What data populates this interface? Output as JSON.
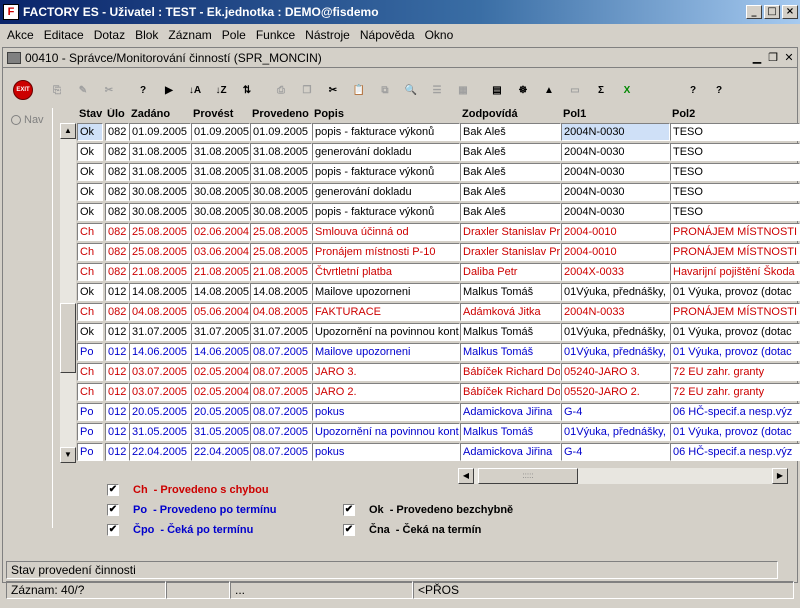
{
  "titlebar": {
    "title": "FACTORY ES - Uživatel : TEST - Ek.jednotka : DEMO@fisdemo",
    "app_icon": "F"
  },
  "menu": [
    "Akce",
    "Editace",
    "Dotaz",
    "Blok",
    "Záznam",
    "Pole",
    "Funkce",
    "Nástroje",
    "Nápověda",
    "Okno"
  ],
  "form": {
    "title": "00410 - Správce/Monitorování činností (SPR_MONCIN)"
  },
  "toolbar": {
    "exit_label": "EXIT"
  },
  "nav": {
    "label": "Nav"
  },
  "columns": [
    "Stav",
    "Úlo",
    "Zadáno",
    "Provést",
    "Provedeno",
    "Popis",
    "Zodpovídá",
    "Pol1",
    "Pol2"
  ],
  "colors": {
    "black": "#000000",
    "red": "#cc0000",
    "blue": "#0000cc"
  },
  "rows": [
    {
      "c": "black",
      "v": [
        "Ok",
        "082",
        "01.09.2005",
        "01.09.2005",
        "01.09.2005",
        "popis - fakturace výkonů",
        "Bak Aleš",
        "2004N-0030",
        "TESO"
      ]
    },
    {
      "c": "black",
      "v": [
        "Ok",
        "082",
        "31.08.2005",
        "31.08.2005",
        "31.08.2005",
        "generování dokladu",
        "Bak Aleš",
        "2004N-0030",
        "TESO"
      ]
    },
    {
      "c": "black",
      "v": [
        "Ok",
        "082",
        "31.08.2005",
        "31.08.2005",
        "31.08.2005",
        "popis - fakturace výkonů",
        "Bak Aleš",
        "2004N-0030",
        "TESO"
      ]
    },
    {
      "c": "black",
      "v": [
        "Ok",
        "082",
        "30.08.2005",
        "30.08.2005",
        "30.08.2005",
        "generování dokladu",
        "Bak Aleš",
        "2004N-0030",
        "TESO"
      ]
    },
    {
      "c": "black",
      "v": [
        "Ok",
        "082",
        "30.08.2005",
        "30.08.2005",
        "30.08.2005",
        "popis - fakturace výkonů",
        "Bak Aleš",
        "2004N-0030",
        "TESO"
      ]
    },
    {
      "c": "red",
      "v": [
        "Ch",
        "082",
        "25.08.2005",
        "02.06.2004",
        "25.08.2005",
        "Smlouva účinná od",
        "Draxler Stanislav Pr",
        "2004-0010",
        "PRONÁJEM MÍSTNOSTI 3"
      ]
    },
    {
      "c": "red",
      "v": [
        "Ch",
        "082",
        "25.08.2005",
        "03.06.2004",
        "25.08.2005",
        "Pronájem místnosti P-10",
        "Draxler Stanislav Pr",
        "2004-0010",
        "PRONÁJEM MÍSTNOSTI 3"
      ]
    },
    {
      "c": "red",
      "v": [
        "Ch",
        "082",
        "21.08.2005",
        "21.08.2005",
        "21.08.2005",
        "Čtvrtletní platba",
        "Daliba Petr",
        "2004X-0033",
        "Havarijní pojištění  Škoda"
      ]
    },
    {
      "c": "black",
      "v": [
        "Ok",
        "012",
        "14.08.2005",
        "14.08.2005",
        "14.08.2005",
        "Mailove upozorneni",
        "Malkus Tomáš",
        "01Výuka, přednášky,",
        "01 Výuka, provoz (dotac"
      ]
    },
    {
      "c": "red",
      "v": [
        "Ch",
        "082",
        "04.08.2005",
        "05.06.2004",
        "04.08.2005",
        "FAKTURACE",
        "Adámková Jitka",
        "2004N-0033",
        "PRONÁJEM MÍSTNOSTI K"
      ]
    },
    {
      "c": "black",
      "v": [
        "Ok",
        "012",
        "31.07.2005",
        "31.07.2005",
        "31.07.2005",
        "Upozornění na povinnou kontro",
        "Malkus Tomáš",
        "01Výuka, přednášky,",
        "01 Výuka, provoz (dotac"
      ]
    },
    {
      "c": "blue",
      "v": [
        "Po",
        "012",
        "14.06.2005",
        "14.06.2005",
        "08.07.2005",
        "Mailove upozorneni",
        "Malkus Tomáš",
        "01Výuka, přednášky,",
        "01 Výuka, provoz (dotac"
      ]
    },
    {
      "c": "red",
      "v": [
        "Ch",
        "012",
        "03.07.2005",
        "02.05.2004",
        "08.07.2005",
        "JARO 3.",
        "Bábíček Richard Dor",
        "05240-JARO 3.",
        "72 EU zahr. granty"
      ]
    },
    {
      "c": "red",
      "v": [
        "Ch",
        "012",
        "03.07.2005",
        "02.05.2004",
        "08.07.2005",
        "JARO 2.",
        "Bábíček Richard Dor",
        "05520-JARO 2.",
        "72 EU zahr. granty"
      ]
    },
    {
      "c": "blue",
      "v": [
        "Po",
        "012",
        "20.05.2005",
        "20.05.2005",
        "08.07.2005",
        "pokus",
        "Adamickova Jiřina",
        "G-4",
        "06 HČ-specif.a nesp.výz"
      ]
    },
    {
      "c": "blue",
      "v": [
        "Po",
        "012",
        "31.05.2005",
        "31.05.2005",
        "08.07.2005",
        "Upozornění na povinnou kontro",
        "Malkus Tomáš",
        "01Výuka, přednášky,",
        "01 Výuka, provoz (dotac"
      ]
    },
    {
      "c": "blue",
      "v": [
        "Po",
        "012",
        "22.04.2005",
        "22.04.2005",
        "08.07.2005",
        "pokus",
        "Adamickova Jiřina",
        "G-4",
        "06 HČ-specif.a nesp.výz"
      ]
    }
  ],
  "legend": [
    {
      "code": "Ch",
      "text": "- Provedeno s chybou",
      "c": "red"
    },
    {
      "code": "Po",
      "text": "- Provedeno po termínu",
      "c": "blue"
    },
    {
      "code": "Čpo",
      "text": "- Čeká po termínu",
      "c": "blue"
    },
    {
      "code": "Ok",
      "text": "- Provedeno bezchybně",
      "c": "black"
    },
    {
      "code": "Čna",
      "text": "- Čeká na termín",
      "c": "black"
    }
  ],
  "status": {
    "message": "Stav provedení činnosti",
    "record": "Záznam: 40/?",
    "dots": "...",
    "mode": "<PŘOS"
  }
}
